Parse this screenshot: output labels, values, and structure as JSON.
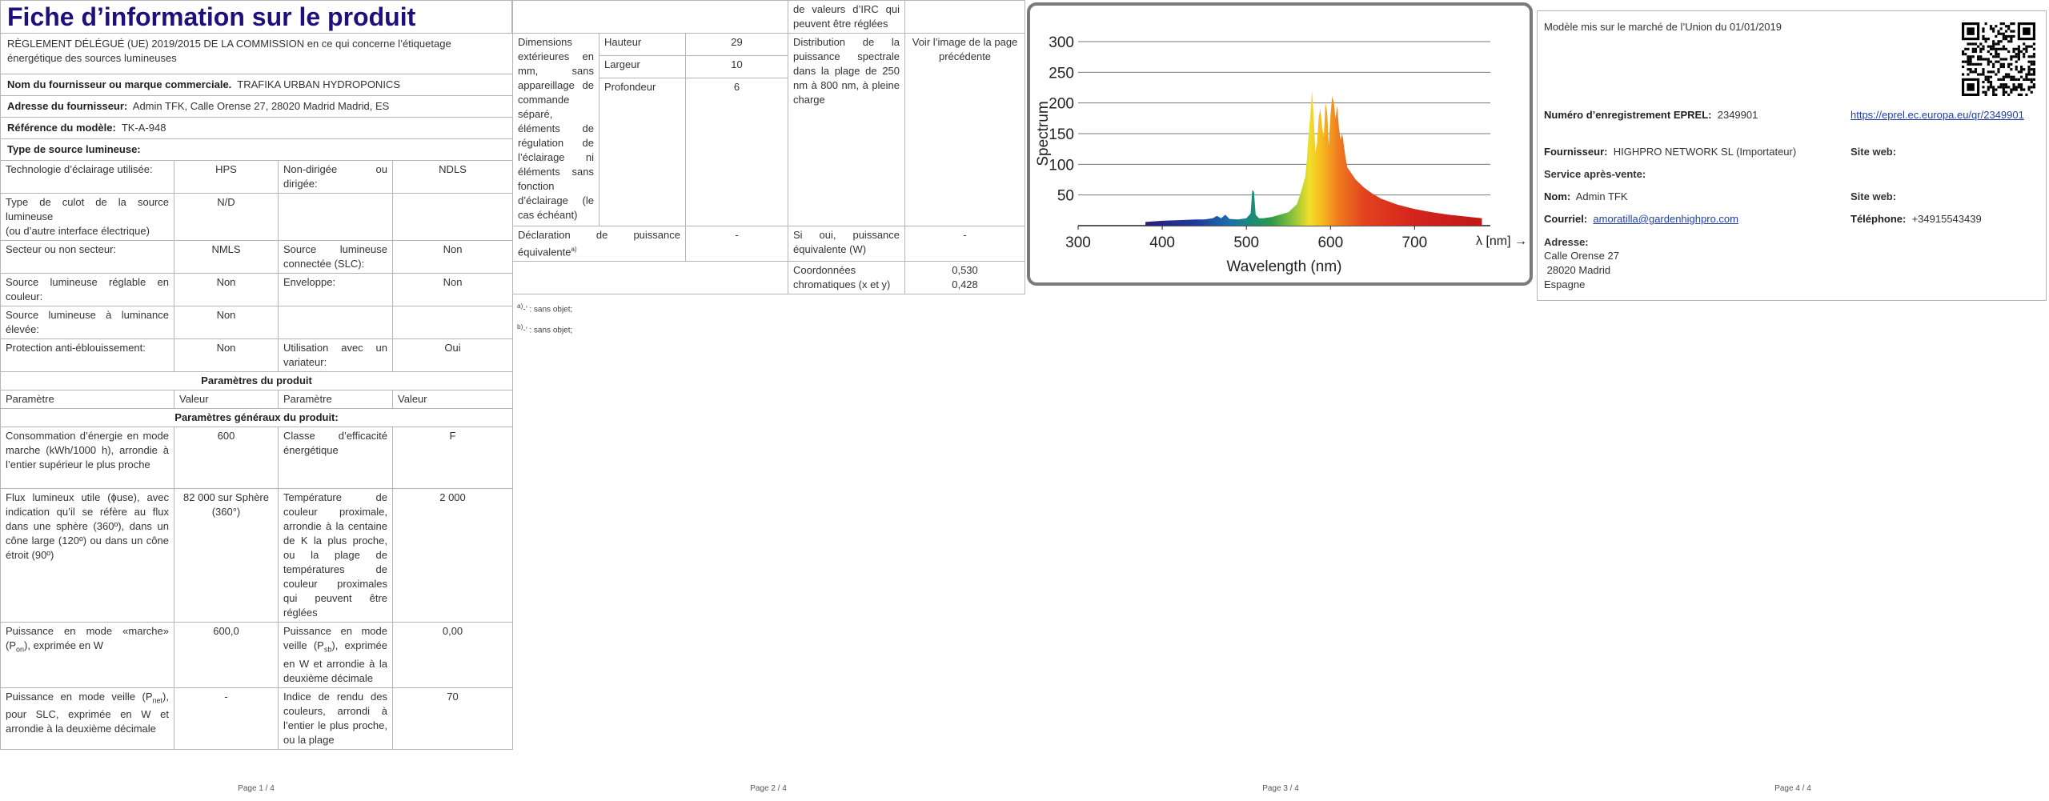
{
  "pages": [
    {
      "footer": "Page 1 / 4"
    },
    {
      "footer": "Page 2 / 4"
    },
    {
      "footer": "Page 3 / 4"
    },
    {
      "footer": "Page 4 / 4"
    }
  ],
  "p1": {
    "title": "Fiche d’information sur le produit",
    "regulation": "RÈGLEMENT DÉLÉGUÉ (UE) 2019/2015 DE LA COMMISSION en ce qui concerne l’étiquetage énergétique des sources lumineuses",
    "supplier_name_label": "Nom du fournisseur ou marque commerciale.",
    "supplier_name": "TRAFIKA URBAN HYDROPONICS",
    "supplier_address_label": "Adresse du fournisseur:",
    "supplier_address": "Admin TFK, Calle Orense 27, 28020 Madrid Madrid, ES",
    "model_ref_label": "Référence du modèle:",
    "model_ref": "TK-A-948",
    "source_type_label": "Type de source lumineuse:",
    "rows": [
      {
        "l1": "Technologie d’éclairage utilisée:",
        "v1": "HPS",
        "l2": "Non-dirigée ou dirigée:",
        "v2": "NDLS"
      },
      {
        "l1": "Type de culot de la source lumineuse\n(ou d’autre interface électrique)",
        "v1": "N/D",
        "l2": "",
        "v2": ""
      },
      {
        "l1": "Secteur ou non secteur:",
        "v1": "NMLS",
        "l2": "Source lumineuse connectée (SLC):",
        "v2": "Non"
      },
      {
        "l1": "Source lumineuse réglable en couleur:",
        "v1": "Non",
        "l2": "Enveloppe:",
        "v2": "Non"
      },
      {
        "l1": "Source lumineuse à luminance élevée:",
        "v1": "Non",
        "l2": "",
        "v2": ""
      },
      {
        "l1": "Protection anti-éblouissement:",
        "v1": "Non",
        "l2": "Utilisation avec un variateur:",
        "v2": "Oui"
      }
    ],
    "params_header": "Paramètres du produit",
    "col_headers": [
      "Paramètre",
      "Valeur",
      "Paramètre",
      "Valeur"
    ],
    "general_header": "Paramètres généraux du produit:",
    "params": [
      {
        "l1": "Consommation d’énergie en mode marche (kWh/1000 h), arrondie à l’entier supérieur le plus proche",
        "v1": "600",
        "l2": "Classe d’efficacité énergétique",
        "v2": "F"
      },
      {
        "l1": "Flux lumineux utile (ɸuse), avec indication qu’il se réfère au flux dans une sphère (360º), dans un cône large (120º) ou dans un cône étroit (90º)",
        "v1": "82 000 sur Sphère (360°)",
        "l2": "Température de couleur proximale, arrondie à la centaine de K la plus proche, ou la plage de températures de couleur proximales qui peuvent être réglées",
        "v2": "2 000"
      },
      {
        "l1a": "Puissance en mode «marche» (P",
        "l1s": "on",
        "l1b": "), exprimée en W",
        "v1": "600,0",
        "l2a": "Puissance en mode veille (P",
        "l2s": "sb",
        "l2b": "), exprimée en W et arrondie à la deuxième décimale",
        "v2": "0,00"
      },
      {
        "l1a": "Puissance en mode veille (P",
        "l1s": "net",
        "l1b": "), pour SLC, exprimée en W et arrondie à la deuxième décimale",
        "v1": "-",
        "l2": "Indice de rendu des couleurs, arrondi à l’entier le plus proche, ou la plage",
        "v2": "70"
      }
    ]
  },
  "p2": {
    "cont_text": "de valeurs d’IRC qui peuvent être réglées",
    "dims_label": "Dimensions extérieures en mm, sans appareillage de commande séparé, éléments de régulation de l’éclairage ni éléments sans fonction d’éclairage (le cas échéant)",
    "dims": [
      {
        "label": "Hauteur",
        "value": "29"
      },
      {
        "label": "Largeur",
        "value": "10"
      },
      {
        "label": "Profondeur",
        "value": "6"
      }
    ],
    "spd_label": "Distribution de la puissance spectrale dans la plage de 250 nm à 800 nm, à pleine charge",
    "spd_value": "Voir l’image de la page précédente",
    "equiv_label": "Déclaration de puissance équivalente",
    "equiv_sup": "a)",
    "equiv_value": "-",
    "equiv_w_label": "Si oui, puissance équivalente (W)",
    "equiv_w_value": "-",
    "chroma_label": "Coordonnées chromatiques (x et y)",
    "chroma_x": "0,530",
    "chroma_y": "0,428",
    "note_a_sup": "a)",
    "note_a": "-’ : sans objet;",
    "note_b_sup": "b)",
    "note_b": "-’ : sans objet;"
  },
  "chart_data": {
    "type": "area",
    "xlabel": "Wavelength (nm)",
    "ylabel": "Spectrum",
    "axis_end_label": "λ [nm]",
    "xlim": [
      300,
      790
    ],
    "ylim": [
      0,
      300
    ],
    "xticks": [
      300,
      400,
      500,
      600,
      700
    ],
    "yticks": [
      50,
      100,
      150,
      200,
      250,
      300
    ],
    "grid": true,
    "x": [
      380,
      400,
      420,
      440,
      450,
      460,
      465,
      470,
      475,
      480,
      490,
      500,
      505,
      507,
      509,
      511,
      515,
      520,
      530,
      540,
      550,
      560,
      565,
      570,
      572,
      574,
      576,
      578,
      580,
      582,
      584,
      586,
      588,
      590,
      592,
      594,
      596,
      598,
      600,
      602,
      604,
      606,
      608,
      610,
      612,
      614,
      616,
      618,
      620,
      625,
      630,
      640,
      650,
      660,
      680,
      700,
      720,
      740,
      760,
      780
    ],
    "values": [
      6,
      8,
      9,
      10,
      10,
      12,
      16,
      12,
      18,
      11,
      10,
      12,
      20,
      58,
      55,
      18,
      12,
      12,
      14,
      18,
      22,
      35,
      55,
      80,
      110,
      150,
      180,
      221,
      175,
      120,
      135,
      178,
      190,
      160,
      145,
      200,
      185,
      130,
      180,
      211,
      200,
      175,
      195,
      160,
      140,
      150,
      130,
      110,
      95,
      85,
      75,
      62,
      52,
      44,
      34,
      27,
      22,
      18,
      15,
      12
    ]
  },
  "p4": {
    "market_date": "Modèle mis sur le marché de l’Union du 01/01/2019",
    "eprel_label": "Numéro d’enregistrement EPREL:",
    "eprel_number": "2349901",
    "eprel_link": "https://eprel.ec.europa.eu/qr/2349901",
    "supplier_label": "Fournisseur:",
    "supplier": "HIGHPRO NETWORK SL (Importateur)",
    "website_label": "Site web:",
    "service_label": "Service après-vente:",
    "name_label": "Nom:",
    "name": "Admin TFK",
    "website_label2": "Site web:",
    "email_label": "Courriel:",
    "email": "amoratilla@gardenhighpro.com",
    "phone_label": "Téléphone:",
    "phone": "+34915543439",
    "address_label": "Adresse:",
    "address_lines": [
      "Calle Orense 27",
      " 28020 Madrid",
      "Espagne"
    ]
  }
}
